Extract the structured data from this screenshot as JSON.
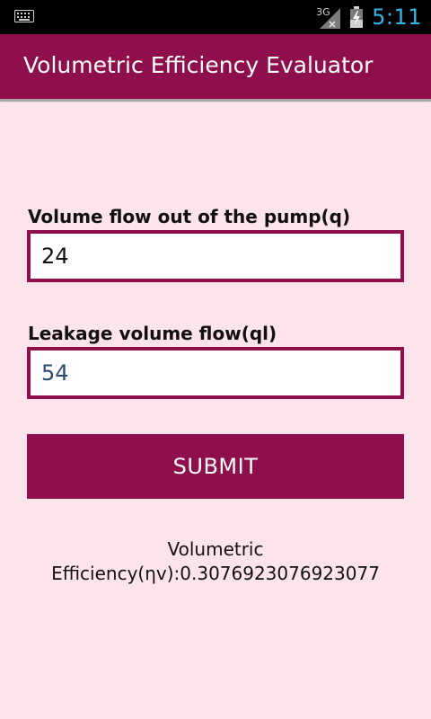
{
  "status_bar": {
    "network_type": "3G",
    "time": "5:11",
    "icons": [
      "keyboard-icon",
      "signal-icon",
      "battery-charging-icon"
    ],
    "accent_color": "#33b5e5"
  },
  "app": {
    "title": "Volumetric Efficiency Evaluator",
    "brand_color": "#8e0f4b",
    "background_color": "#fde4ea"
  },
  "form": {
    "q_label": "Volume flow out of the pump(q)",
    "q_value": "24",
    "ql_label": "Leakage volume flow(ql)",
    "ql_value": "54",
    "submit_label": "SUBMIT"
  },
  "result": {
    "line1": "Volumetric",
    "line2": "Efficiency(ηv):0.3076923076923077"
  }
}
